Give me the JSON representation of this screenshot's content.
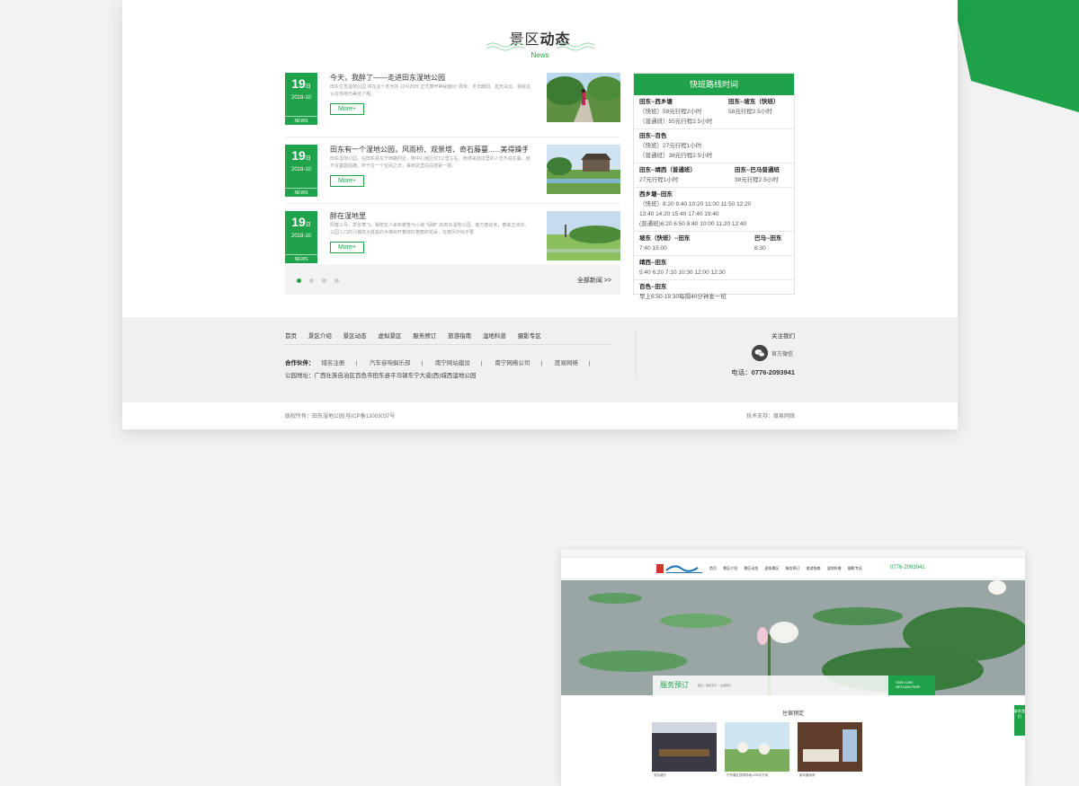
{
  "colors": {
    "accent": "#1fa34a",
    "background": "#f2f2f2"
  },
  "section": {
    "title_light": "景区",
    "title_bold": "动态",
    "subtitle": "News"
  },
  "news": [
    {
      "day": "19",
      "day_suffix": "日",
      "ym": "2018-10",
      "tag": "NEWS",
      "title": "今天，我醉了——走进田东湿地公园",
      "desc": "田东生态湿地公园 将在这个冬天的 12月29日 正式撩开神秘面纱! 周末、冬日暖阳、蓝天白云、我就这么在他地光美远了哦。",
      "more": "More+"
    },
    {
      "day": "19",
      "day_suffix": "日",
      "ym": "2018-10",
      "tag": "NEWS",
      "title": "田东有一个湿地公园，风雨桥、观景塔、奇石藤蔓......美得躁手...",
      "desc": "田东湿地公园，在田东县东宁西路附近，南中心城区仅1公里左右，雨港来游这里的人无不说在赢。纸不住童圆观摘，终于在一个空闲之日，来到这里拍在感受一把。",
      "more": "More+"
    },
    {
      "day": "19",
      "day_suffix": "日",
      "ym": "2018-10",
      "tag": "NEWS",
      "title": "醉在湿地里",
      "desc": "阳春三月，草长莺飞。我陪友人来到被誉为小城 \"绿肺\" 的田东湿地公园。南方春信未，春来正欣欣。公园入口的几棵高大挺拔的木棉树开着鲜红艳丽的花朵，在微风中似乎要",
      "more": "More+"
    }
  ],
  "pager": {
    "all_news": "全部新闻 >>"
  },
  "bus": {
    "title": "快班路线时间",
    "blocks": [
      {
        "lines": [
          "田东--西乡塘",
          "（快班）58元行程2小时",
          "（普通班）55元行程2.5小时"
        ],
        "right": [
          "田东--坡东（快班）",
          "58元行程2.5小时"
        ]
      },
      {
        "lines": [
          "田东--百色",
          "（快班）27元行程1小时",
          "（普通班）38元行程2.5小时"
        ]
      },
      {
        "lines": [
          "田东--靖西（普通班）",
          "27元行程1小时"
        ],
        "right": [
          "田东--巴马普通班",
          "38元行程2.5小时"
        ]
      },
      {
        "lines": [
          "西乡塘--田东",
          "（快班）8:20  9:40 10:20  11:00  11:50  12:20",
          "13:40  14:20  15:40  17:40  19:40",
          "(普通班)6:20  6:50  8:40  10:00  11:20  12:40"
        ]
      },
      {
        "lines": [
          "坡东（快班）--田东",
          "7:40  15:00"
        ],
        "right": [
          "巴马--田东",
          "8:30"
        ]
      },
      {
        "lines": [
          "靖西--田东",
          "5:40  6:20  7:10  10:30  12:00  12:30"
        ]
      },
      {
        "lines": [
          "百色--田东",
          "早上6:50-19:30每隔40分钟发一班"
        ]
      }
    ]
  },
  "footer": {
    "nav": [
      "首页",
      "景区介绍",
      "景区动态",
      "虚拟景区",
      "服务预订",
      "旅游指南",
      "湿地科普",
      "摄影专区"
    ],
    "partners_label": "合作伙伴：",
    "partners": [
      "域名注册",
      "|",
      "汽车音响俱乐部",
      "|",
      "南宁网站建设",
      "|",
      "南宁网络公司",
      "|",
      "度易网络",
      "|"
    ],
    "address": "公园地址：广西壮族自治区百色市田东县平马镇东宁大道(西)城西湿地公园",
    "follow": "关注我们",
    "wechat": "官方微信",
    "tel_label": "电话：",
    "tel": "0776-2093941",
    "copyright": "版权所有：田东湿地公园 桂ICP备13003037号",
    "tech": "技术支持：度易网络"
  },
  "mini": {
    "menu": [
      "首页",
      "景区介绍",
      "景区动态",
      "虚拟景区",
      "服务预订",
      "旅游指南",
      "湿地科普",
      "摄影专区"
    ],
    "tel": "0776-2093941",
    "banner_title": "服务预订",
    "banner_crumb": "首页 > 服务预订 > 住宿预定",
    "banner_badge": "TAMU LAKE WETLAND PARK",
    "section": "住宿预定",
    "captions": [
      "多功能厅",
      "户外婚礼现场场地1200平方米",
      "豪华套间房"
    ],
    "side": "联系我们"
  }
}
